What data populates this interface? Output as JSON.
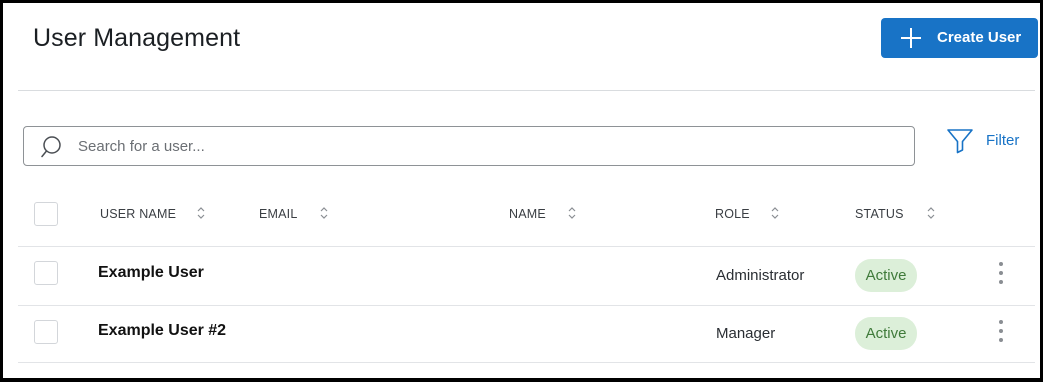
{
  "header": {
    "title": "User Management",
    "create_button_label": "Create User"
  },
  "search": {
    "placeholder": "Search for a user...",
    "value": ""
  },
  "filter": {
    "label": "Filter"
  },
  "table": {
    "columns": [
      "USER NAME",
      "EMAIL",
      "NAME",
      "ROLE",
      "STATUS"
    ],
    "rows": [
      {
        "user_name": "Example User",
        "email": "",
        "name": "",
        "role": "Administrator",
        "status": "Active"
      },
      {
        "user_name": "Example User #2",
        "email": "",
        "name": "",
        "role": "Manager",
        "status": "Active"
      }
    ]
  },
  "icons": {
    "create": "plus-icon",
    "search": "search-icon",
    "filter": "filter-icon",
    "sort": "sort-icon",
    "row_menu": "more-vertical-icon"
  },
  "colors": {
    "primary": "#1873c6",
    "status_active_bg": "#dcefd9",
    "status_active_text": "#3f7a3a"
  }
}
